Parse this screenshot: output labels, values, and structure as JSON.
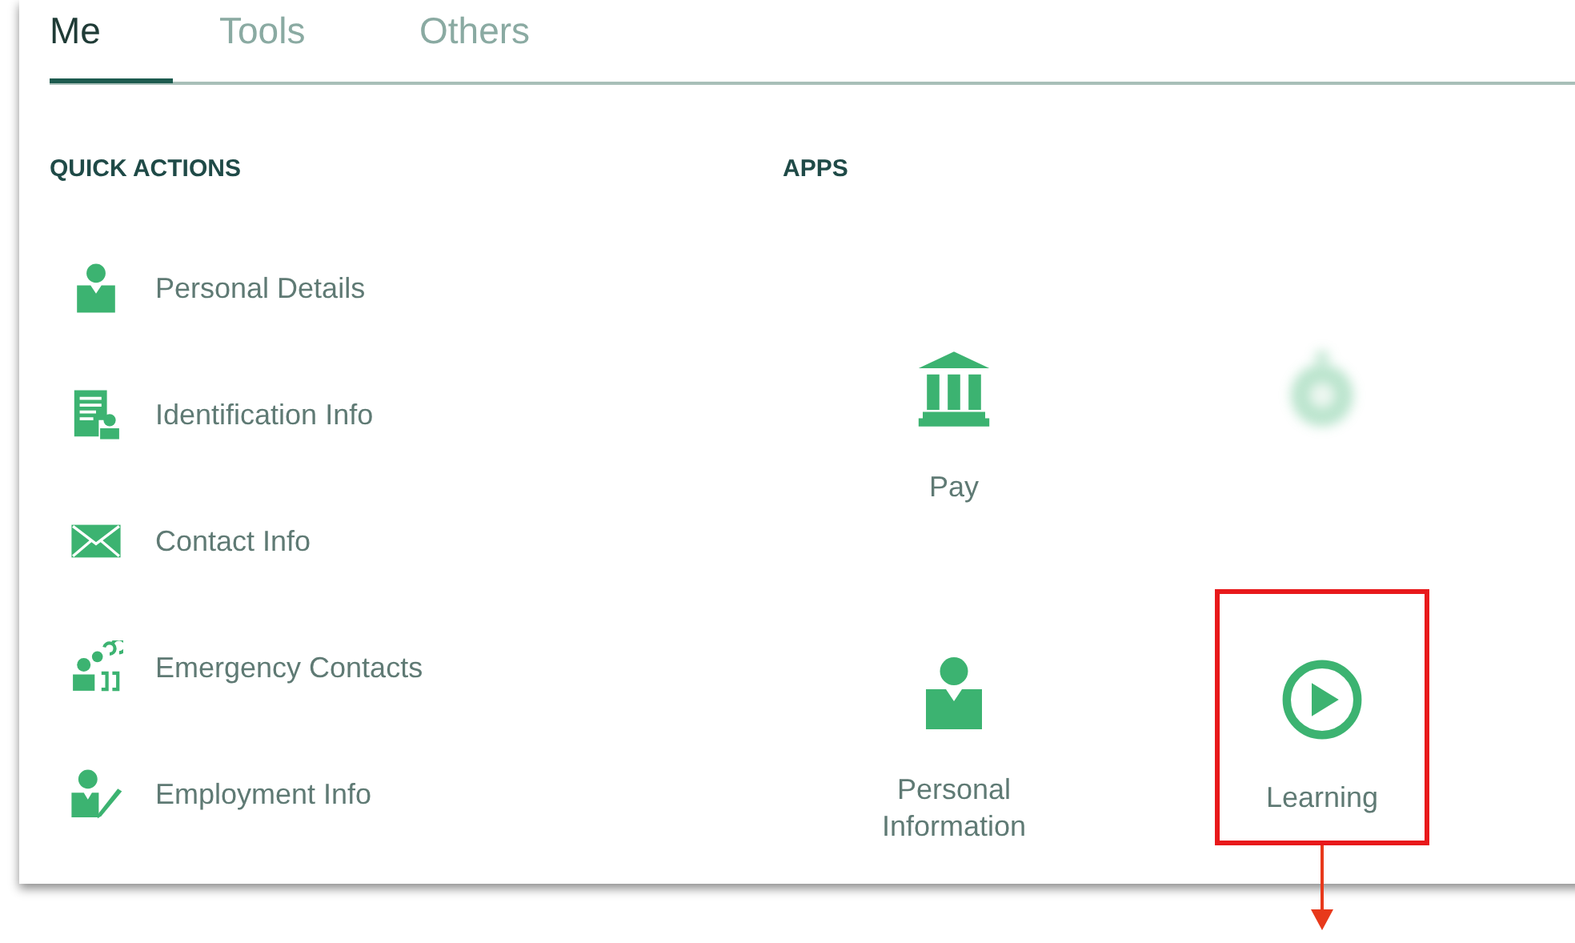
{
  "tabs": [
    {
      "label": "Me",
      "selected": true
    },
    {
      "label": "Tools",
      "selected": false
    },
    {
      "label": "Others",
      "selected": false
    }
  ],
  "quick_actions": {
    "heading": "QUICK ACTIONS",
    "items": [
      {
        "label": "Personal Details",
        "kind": "person"
      },
      {
        "label": "Identification Info",
        "kind": "id"
      },
      {
        "label": "Contact Info",
        "kind": "mail"
      },
      {
        "label": "Emergency Contacts",
        "kind": "contacts"
      },
      {
        "label": "Employment Info",
        "kind": "employment"
      }
    ]
  },
  "apps": {
    "heading": "APPS",
    "items": [
      {
        "label": "Pay",
        "kind": "bank",
        "blurred": false,
        "highlighted": false
      },
      {
        "kind": "clock",
        "blurred": true,
        "highlighted": false
      },
      {
        "label": "Personal\nInformation",
        "kind": "person",
        "blurred": false,
        "highlighted": false
      },
      {
        "label": "Learning",
        "kind": "play",
        "blurred": false,
        "highlighted": true
      }
    ]
  }
}
